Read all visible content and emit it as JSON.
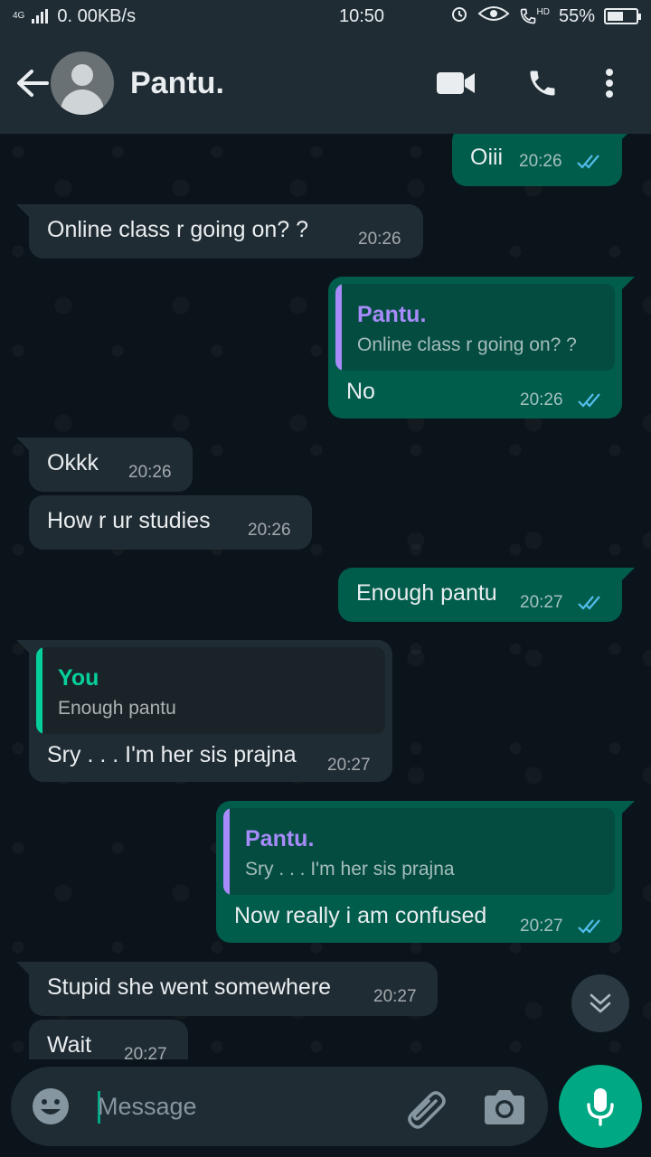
{
  "status_bar": {
    "network": "4G",
    "speed": "0. 00KB/s",
    "time": "10:50",
    "hd_label": "HD",
    "battery": "55%",
    "battery_level": 0.55
  },
  "header": {
    "contact_name": "Pantu."
  },
  "messages": [
    {
      "direction": "out",
      "text": "Oiii",
      "time": "20:26",
      "status": "read"
    },
    {
      "direction": "in",
      "text": "Online class r going on? ?",
      "time": "20:26"
    },
    {
      "direction": "out",
      "quote_name": "Pantu.",
      "quote_text": "Online class r going on? ?",
      "text": "No",
      "time": "20:26",
      "status": "read"
    },
    {
      "direction": "in",
      "text": "Okkk",
      "time": "20:26"
    },
    {
      "direction": "in",
      "text": "How r ur studies",
      "time": "20:26"
    },
    {
      "direction": "out",
      "text": "Enough pantu",
      "time": "20:27",
      "status": "read"
    },
    {
      "direction": "in",
      "quote_name": "You",
      "quote_text": "Enough pantu",
      "text": "Sry . . . I'm her sis prajna",
      "time": "20:27"
    },
    {
      "direction": "out",
      "quote_name": "Pantu.",
      "quote_text": "Sry . . . I'm her sis prajna",
      "text": "Now really i am confused",
      "time": "20:27",
      "status": "read"
    },
    {
      "direction": "in",
      "text": "Stupid she went somewhere",
      "time": "20:27"
    },
    {
      "direction": "in",
      "text": "Wait",
      "time": "20:27"
    }
  ],
  "input": {
    "placeholder": "Message"
  },
  "colors": {
    "outgoing_bubble": "#005c4b",
    "incoming_bubble": "#202c33",
    "accent": "#00a884",
    "quote_pantu": "#a78bfa",
    "quote_you": "#06cf9c",
    "read_ticks": "#53bdeb"
  }
}
